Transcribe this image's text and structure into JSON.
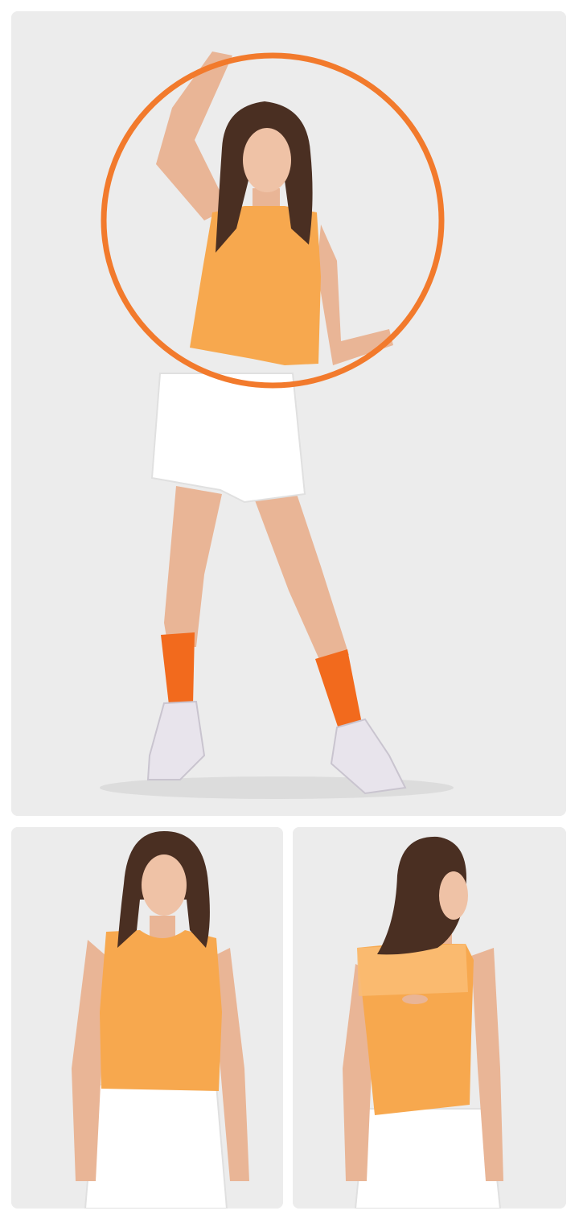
{
  "colors": {
    "background": "#ececec",
    "tank_top": "#f7a84e",
    "hoop": "#f27a2c",
    "socks": "#f26a1d",
    "shorts": "#ffffff",
    "skin": "#e9b596",
    "hair": "#4a2f22",
    "sneakers": "#e8e4ec"
  },
  "images": [
    {
      "view": "full-body-with-hula-hoop"
    },
    {
      "view": "front-closeup"
    },
    {
      "view": "back-closeup"
    }
  ]
}
